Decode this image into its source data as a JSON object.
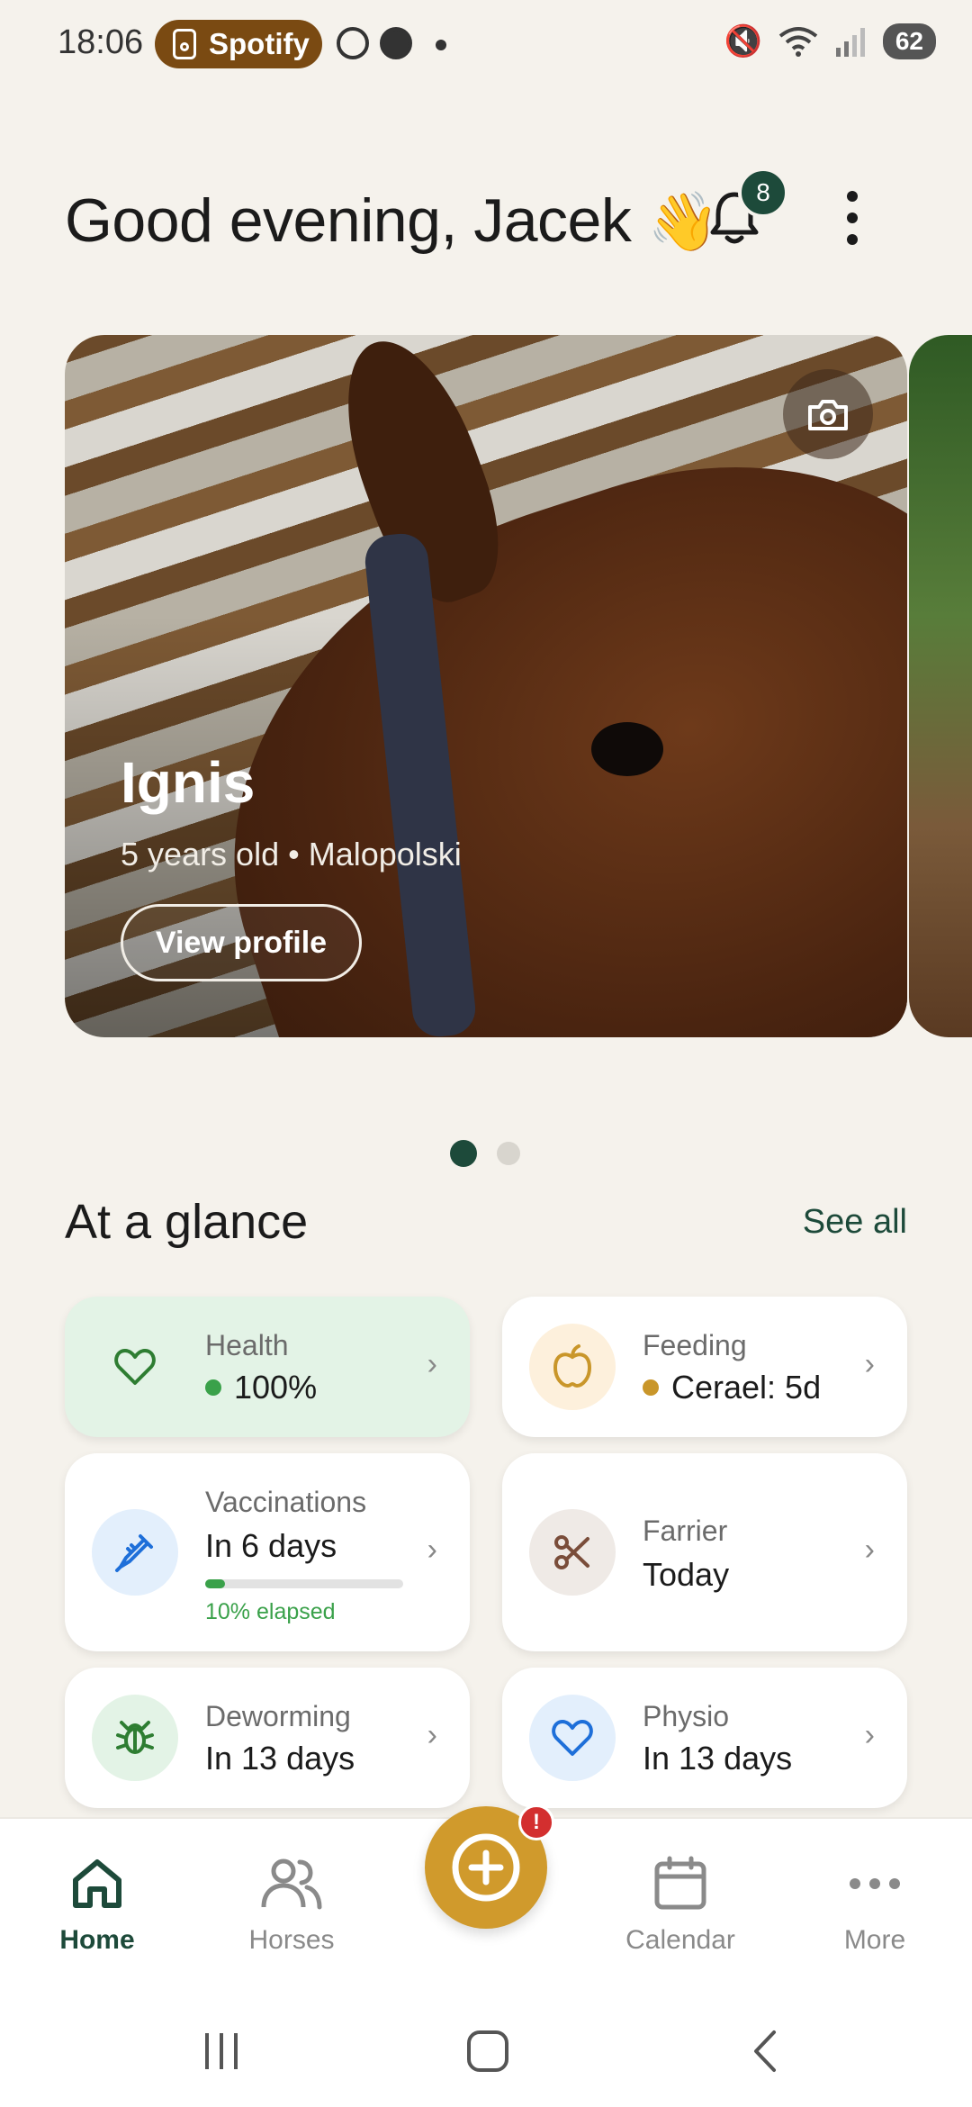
{
  "status_bar": {
    "time": "18:06",
    "media_chip": "Spotify",
    "notification_icons": [
      "whatsapp-icon",
      "facebook-icon"
    ],
    "battery": "62"
  },
  "header": {
    "greeting": "Good evening, Jacek",
    "greeting_emoji": "👋",
    "notifications_count": "8"
  },
  "carousel": {
    "active_index": 0,
    "total": 2,
    "cards": [
      {
        "name": "Ignis",
        "details": "5 years old • Malopolski",
        "button_label": "View profile"
      }
    ]
  },
  "glance": {
    "title": "At a glance",
    "see_all": "See all",
    "cards": [
      {
        "id": "health",
        "label": "Health",
        "value": "100%",
        "bullet_color": "#3aa14a"
      },
      {
        "id": "feeding",
        "label": "Feeding",
        "value": "Cerael: 5d",
        "bullet_color": "#c9962a"
      },
      {
        "id": "vaccinations",
        "label": "Vaccinations",
        "value": "In 6 days",
        "progress": 0.1,
        "progress_label": "10% elapsed"
      },
      {
        "id": "farrier",
        "label": "Farrier",
        "value": "Today"
      },
      {
        "id": "deworming",
        "label": "Deworming",
        "value": "In 13 days"
      },
      {
        "id": "physio",
        "label": "Physio",
        "value": "In 13 days"
      }
    ]
  },
  "bottom_nav": {
    "items": [
      {
        "label": "Home",
        "icon": "home-icon",
        "active": true
      },
      {
        "label": "Horses",
        "icon": "horses-icon",
        "active": false
      },
      {
        "label": "Calendar",
        "icon": "calendar-icon",
        "active": false
      },
      {
        "label": "More",
        "icon": "more-icon",
        "active": false
      }
    ],
    "fab_icon": "plus-icon",
    "fab_badge": "!"
  },
  "colors": {
    "accent_green": "#1d4a3a",
    "fab_gold": "#d09a2c",
    "health_bg": "#e3f3e6"
  }
}
